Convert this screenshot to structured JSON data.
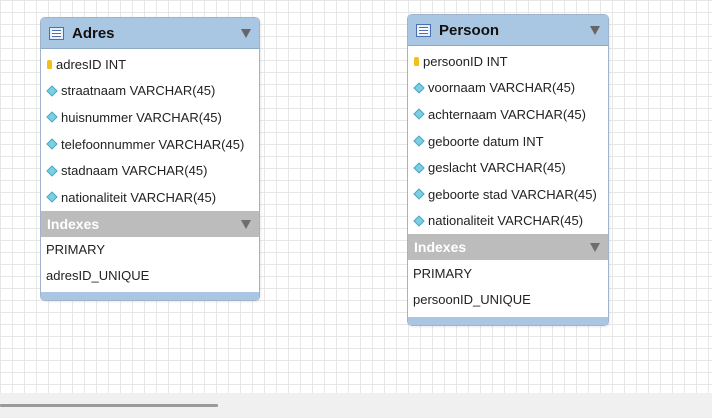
{
  "tables": {
    "adres": {
      "title": "Adres",
      "columns": [
        {
          "text": "adresID INT",
          "icon": "key-icon"
        },
        {
          "text": "straatnaam VARCHAR(45)",
          "icon": "column-diamond-icon"
        },
        {
          "text": "huisnummer VARCHAR(45)",
          "icon": "column-diamond-icon"
        },
        {
          "text": "telefoonnummer VARCHAR(45)",
          "icon": "column-diamond-icon"
        },
        {
          "text": "stadnaam VARCHAR(45)",
          "icon": "column-diamond-icon"
        },
        {
          "text": "nationaliteit VARCHAR(45)",
          "icon": "column-diamond-icon"
        }
      ],
      "indexes_label": "Indexes",
      "indexes": [
        "PRIMARY",
        "adresID_UNIQUE"
      ]
    },
    "persoon": {
      "title": "Persoon",
      "columns": [
        {
          "text": "persoonID INT",
          "icon": "key-icon"
        },
        {
          "text": "voornaam VARCHAR(45)",
          "icon": "column-diamond-icon"
        },
        {
          "text": "achternaam VARCHAR(45)",
          "icon": "column-diamond-icon"
        },
        {
          "text": "geboorte datum INT",
          "icon": "column-diamond-icon"
        },
        {
          "text": "geslacht VARCHAR(45)",
          "icon": "column-diamond-icon"
        },
        {
          "text": "geboorte stad VARCHAR(45)",
          "icon": "column-diamond-icon"
        },
        {
          "text": "nationaliteit VARCHAR(45)",
          "icon": "column-diamond-icon"
        }
      ],
      "indexes_label": "Indexes",
      "indexes": [
        "PRIMARY",
        "persoonID_UNIQUE"
      ]
    }
  },
  "colors": {
    "header": "#a9c6e2",
    "indexes_header": "#bcbcbc",
    "key": "#f2c01e",
    "column_diamond": "#7ccfe2"
  }
}
